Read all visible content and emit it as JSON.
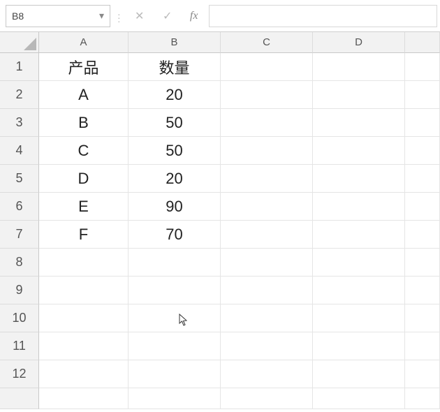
{
  "name_box": {
    "value": "B8"
  },
  "formula_bar": {
    "cancel_icon": "✕",
    "accept_icon": "✓",
    "fx_label": "fx",
    "input_value": ""
  },
  "columns": [
    "A",
    "B",
    "C",
    "D",
    ""
  ],
  "row_numbers": [
    "1",
    "2",
    "3",
    "4",
    "5",
    "6",
    "7",
    "8",
    "9",
    "10",
    "11",
    "12",
    ""
  ],
  "cells": {
    "A1": "产品",
    "B1": "数量",
    "A2": "A",
    "B2": "20",
    "A3": "B",
    "B3": "50",
    "A4": "C",
    "B4": "50",
    "A5": "D",
    "B5": "20",
    "A6": "E",
    "B6": "90",
    "A7": "F",
    "B7": "70"
  },
  "chart_data": {
    "type": "table",
    "columns": [
      "产品",
      "数量"
    ],
    "rows": [
      [
        "A",
        20
      ],
      [
        "B",
        50
      ],
      [
        "C",
        50
      ],
      [
        "D",
        20
      ],
      [
        "E",
        90
      ],
      [
        "F",
        70
      ]
    ]
  },
  "active_cell": "B8"
}
